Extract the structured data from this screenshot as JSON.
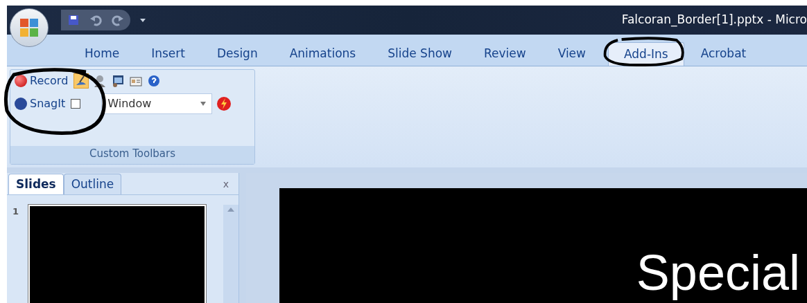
{
  "window": {
    "title": "Falcoran_Border[1].pptx - Micro"
  },
  "ribbon_tabs": [
    {
      "label": "Home",
      "selected": false
    },
    {
      "label": "Insert",
      "selected": false
    },
    {
      "label": "Design",
      "selected": false
    },
    {
      "label": "Animations",
      "selected": false
    },
    {
      "label": "Slide Show",
      "selected": false
    },
    {
      "label": "Review",
      "selected": false
    },
    {
      "label": "View",
      "selected": false
    },
    {
      "label": "Add-Ins",
      "selected": true
    },
    {
      "label": "Acrobat",
      "selected": false
    }
  ],
  "ribbon_group": {
    "title": "Custom Toolbars",
    "record_button": "Record",
    "snagit_button": "SnagIt",
    "snagit_checked": false,
    "capture_mode": "Window"
  },
  "pane_tabs": [
    {
      "label": "Slides",
      "selected": true
    },
    {
      "label": "Outline",
      "selected": false
    }
  ],
  "pane_close": "x",
  "thumbnails": [
    {
      "number": "1"
    }
  ],
  "slide": {
    "title": "Special"
  }
}
